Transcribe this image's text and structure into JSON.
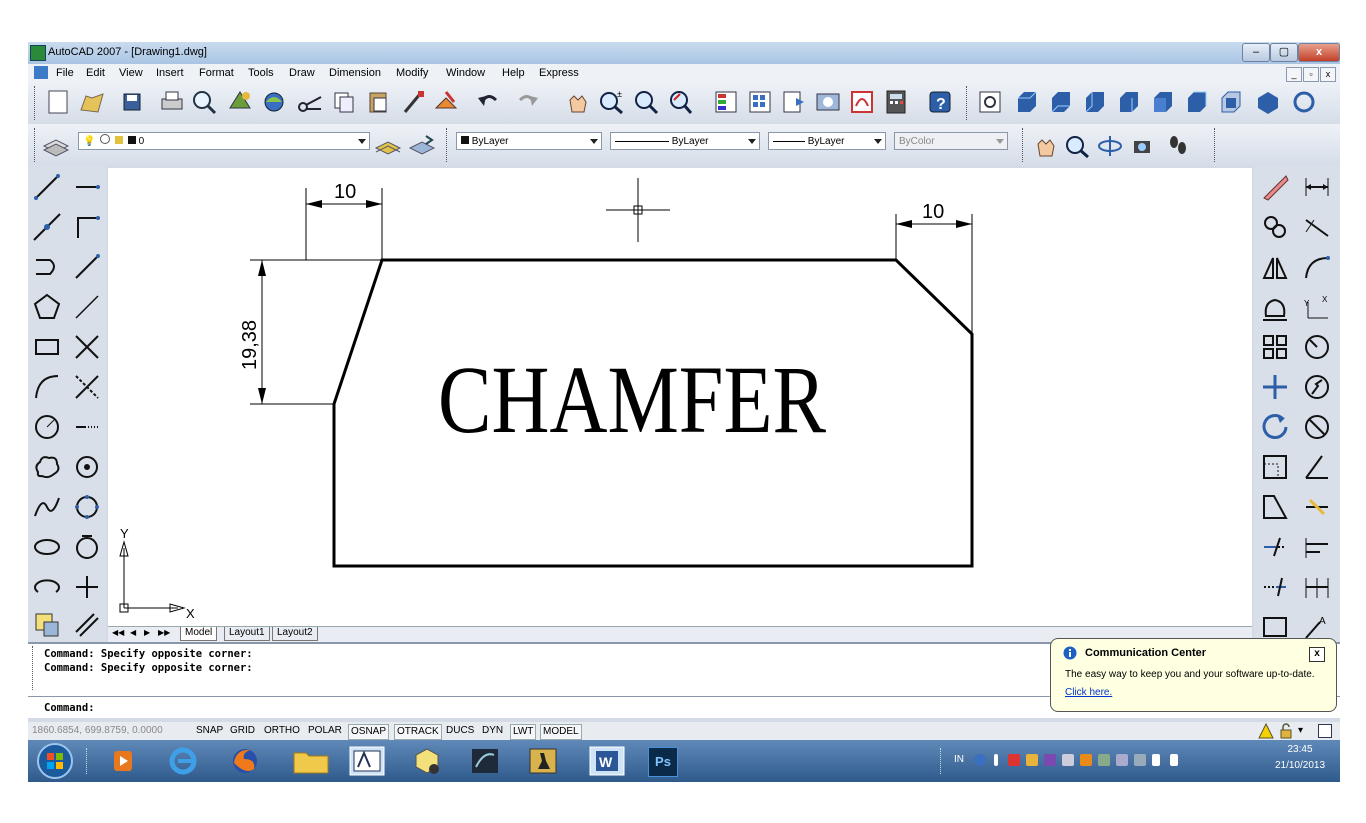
{
  "window": {
    "title": "AutoCAD 2007 - [Drawing1.dwg]",
    "min": "–",
    "max": "▢",
    "close": "x"
  },
  "menu": [
    "File",
    "Edit",
    "View",
    "Insert",
    "Format",
    "Tools",
    "Draw",
    "Dimension",
    "Modify",
    "Window",
    "Help",
    "Express"
  ],
  "mdi_buttons": [
    "_",
    "▫",
    "x"
  ],
  "properties": {
    "layer": "0",
    "color": "ByLayer",
    "linetype": "ByLayer",
    "lineweight": "ByLayer",
    "plotstyle": "ByColor"
  },
  "drawing": {
    "text": "CHAMFER",
    "dim_top_left": "10",
    "dim_top_right": "10",
    "dim_vertical": "19,38",
    "axis_x": "X",
    "axis_y": "Y"
  },
  "tabs": [
    "Model",
    "Layout1",
    "Layout2"
  ],
  "tab_nav": [
    "◀◀",
    "◀",
    "▶",
    "▶▶"
  ],
  "command_lines": [
    "Command: Specify opposite corner:",
    "Command: Specify opposite corner:",
    "Command:"
  ],
  "status": {
    "coords": "1860.6854, 699.8759, 0.0000",
    "buttons": [
      "SNAP",
      "GRID",
      "ORTHO",
      "POLAR",
      "OSNAP",
      "OTRACK",
      "DUCS",
      "DYN",
      "LWT",
      "MODEL"
    ]
  },
  "balloon": {
    "title": "Communication Center",
    "body": "The easy way to keep you and your software up-to-date.",
    "link": "Click here.",
    "close": "x"
  },
  "taskbar": {
    "lang": "IN",
    "time": "23:45",
    "date": "21/10/2013",
    "ps": "Ps"
  },
  "colors": {
    "accent": "#2f5a8c",
    "canvas": "#ffffff",
    "balloon": "#ffffe1"
  }
}
